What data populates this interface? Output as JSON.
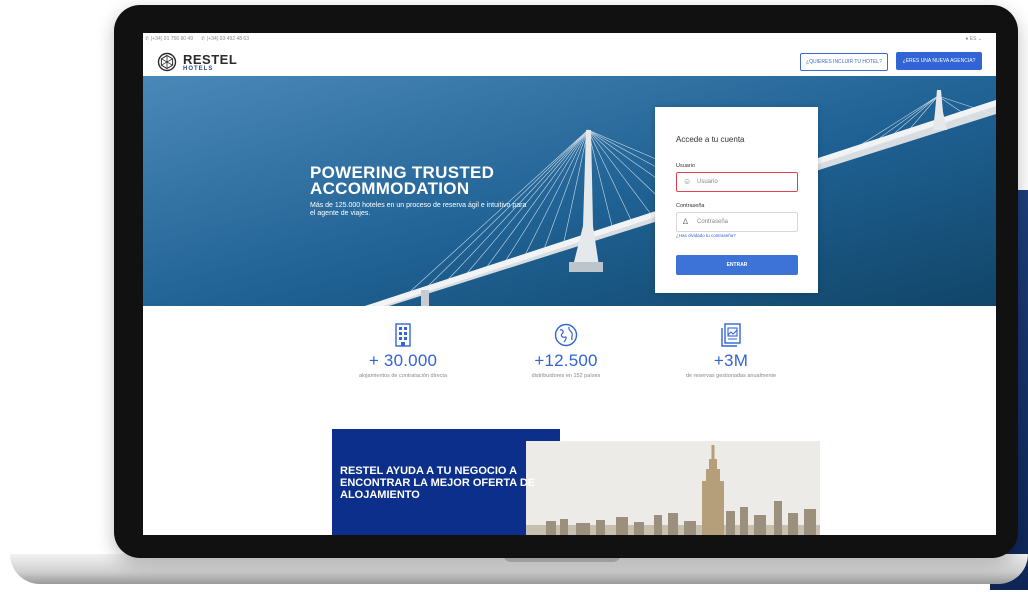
{
  "topbar": {
    "phones": [
      "(+34) 91 756 90 49",
      "(+34) 93 492 48 63"
    ],
    "language": "ES"
  },
  "header": {
    "brand": "RESTEL",
    "brand_sub": "HOTELS",
    "include_hotel_button": "¿QUIERES INCLUIR TU HOTEL?",
    "new_agency_button": "¿ERES UNA NUEVA AGENCIA?"
  },
  "hero": {
    "title": "POWERING TRUSTED ACCOMMODATION",
    "subtitle": "Más de 125.000 hoteles en un proceso de reserva ágil e intuitivo para el agente de viajes."
  },
  "login": {
    "title": "Accede a tu cuenta",
    "user_label": "Usuario",
    "user_placeholder": "Usuario",
    "password_label": "Contraseña",
    "password_placeholder": "Contraseña",
    "forgot_link": "¿Has olvidado tu contraseña?",
    "submit_button": "ENTRAR"
  },
  "stats": [
    {
      "icon": "building-icon",
      "number": "+ 30.000",
      "label": "alojamientos de contratación directa"
    },
    {
      "icon": "globe-icon",
      "number": "+12.500",
      "label": "distribuidores en 152 países"
    },
    {
      "icon": "bookings-icon",
      "number": "+3M",
      "label": "de reservas gestionadas anualmente"
    }
  ],
  "promo": {
    "heading": "RESTEL AYUDA A TU NEGOCIO A ENCONTRAR LA MEJOR OFERTA DE ALOJAMIENTO"
  },
  "colors": {
    "accent": "#3264d6",
    "navy": "#0b2f8a",
    "error": "#e0434f"
  }
}
